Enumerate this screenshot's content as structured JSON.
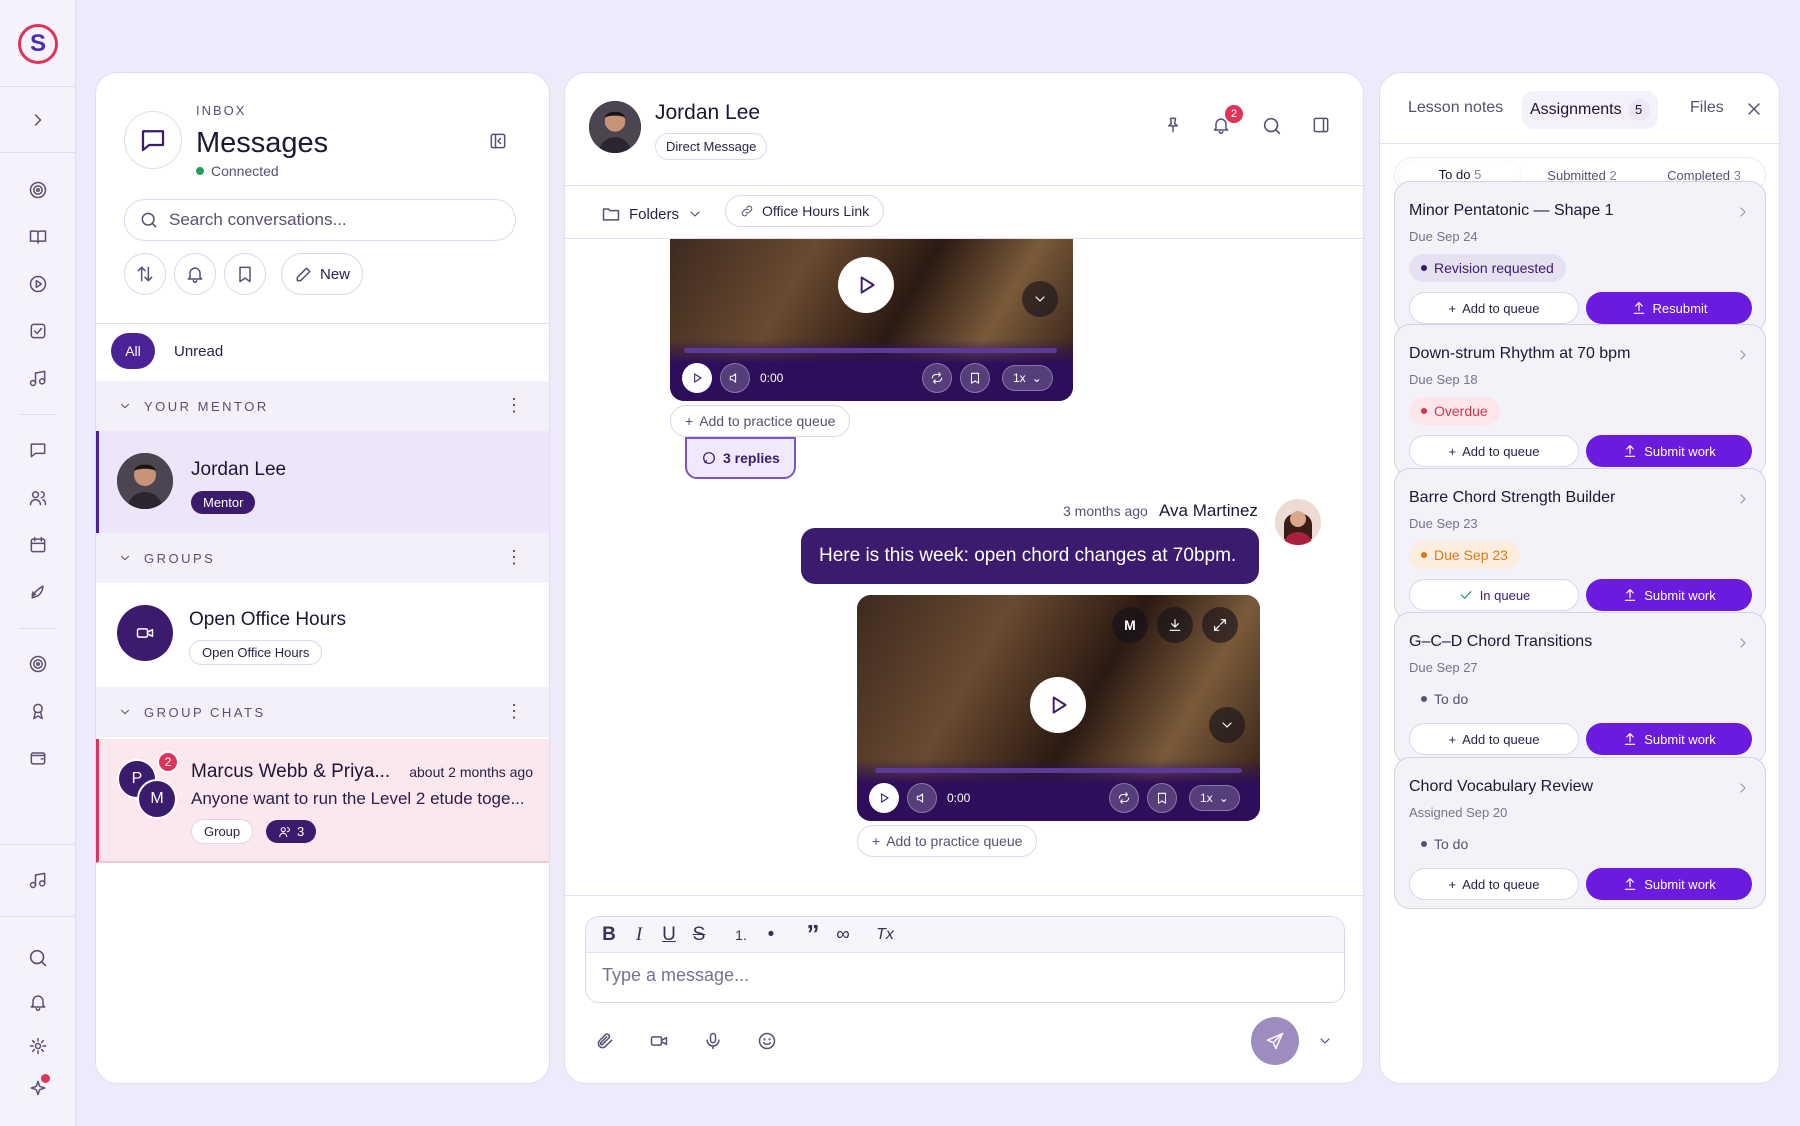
{
  "rail": {
    "icons": [
      "chevron-right-icon",
      "target-icon",
      "book-icon",
      "play-circle-icon",
      "checklist-icon",
      "music-note-icon",
      "chat-icon",
      "users-icon",
      "calendar-icon",
      "rocket-icon",
      "target-icon",
      "award-icon",
      "wallet-icon",
      "music-note-icon",
      "search-icon",
      "bell-icon",
      "settings-icon",
      "sparkle-icon"
    ]
  },
  "inbox": {
    "kicker": "INBOX",
    "title": "Messages",
    "status": "Connected",
    "search_placeholder": "Search conversations...",
    "new_label": "New",
    "filter_all": "All",
    "filter_unread": "Unread",
    "sections": {
      "mentor": "YOUR MENTOR",
      "groups": "GROUPS",
      "group_chats": "GROUP CHATS"
    },
    "mentor": {
      "name": "Jordan Lee",
      "tag": "Mentor"
    },
    "group": {
      "name": "Open Office Hours",
      "tag": "Open Office Hours"
    },
    "group_chat": {
      "name": "Marcus Webb & Priya...",
      "time": "about 2 months ago",
      "preview": "Anyone want to run the Level 2 etude toge...",
      "tag": "Group",
      "members": "3",
      "unread": "2",
      "avatar_p": "P",
      "avatar_m": "M"
    }
  },
  "chat": {
    "name": "Jordan Lee",
    "subtitle": "Direct Message",
    "notif_count": "2",
    "folders": "Folders",
    "office_link": "Office Hours Link",
    "video1": {
      "time": "0:00",
      "speed": "1x"
    },
    "add_queue_1": "Add to practice queue",
    "replies": "3 replies",
    "msg_meta_time": "3 months ago",
    "msg_author": "Ava Martinez",
    "msg_text": "Here is this week: open chord changes at 70bpm.",
    "video2": {
      "time": "0:00",
      "speed": "1x",
      "m_label": "M"
    },
    "add_queue_2": "Add to practice queue",
    "editor_tools": [
      "B",
      "I",
      "U",
      "S",
      "1.",
      "•",
      "”",
      "∞",
      "Tx"
    ],
    "input_placeholder": "Type a message..."
  },
  "assignments": {
    "tabs": [
      {
        "label": "Lesson notes"
      },
      {
        "label": "Assignments",
        "count": "5"
      },
      {
        "label": "Files"
      }
    ],
    "segments": [
      {
        "label": "To do",
        "count": "5"
      },
      {
        "label": "Submitted",
        "count": "2"
      },
      {
        "label": "Completed",
        "count": "3"
      }
    ],
    "cards": [
      {
        "title": "Minor Pentatonic — Shape 1",
        "date": "Due Sep 24",
        "status": "Revision requested",
        "status_color": "#3a1b6e",
        "status_bg": "#e6e1f1",
        "queue": "Add to queue",
        "action": "Resubmit"
      },
      {
        "title": "Down-strum Rhythm at 70 bpm",
        "date": "Due Sep 18",
        "status": "Overdue",
        "status_color": "#d8334f",
        "status_bg": "#fbe6ea",
        "queue": "Add to queue",
        "action": "Submit work"
      },
      {
        "title": "Barre Chord Strength Builder",
        "date": "Due Sep 23",
        "status": "Due Sep 23",
        "status_color": "#d97a1c",
        "status_bg": "#fbeede",
        "queue": "In queue",
        "action": "Submit work"
      },
      {
        "title": "G–C–D Chord Transitions",
        "date": "Due Sep 27",
        "status": "To do",
        "status_color": "#5a4f73",
        "status_bg": "#f4f2f9",
        "queue": "Add to queue",
        "action": "Submit work"
      },
      {
        "title": "Chord Vocabulary Review",
        "date": "Assigned Sep 20",
        "status": "To do",
        "status_color": "#5a4f73",
        "status_bg": "#f4f2f9",
        "queue": "Add to queue",
        "action": "Submit work"
      }
    ]
  },
  "colors": {
    "accent": "#6a1bde",
    "brand_dark": "#3a1b6e",
    "danger": "#e0335a",
    "bg": "#efeafb"
  }
}
